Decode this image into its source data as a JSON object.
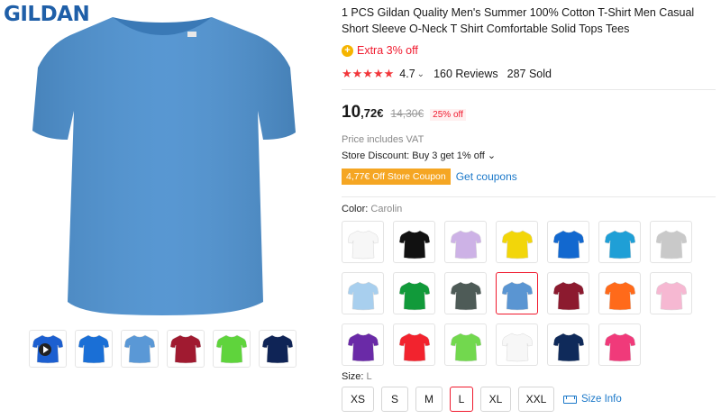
{
  "brand": {
    "logo_text": "GILDAN",
    "logo_color": "#1f5fa8"
  },
  "product": {
    "title": "1 PCS Gildan Quality Men's Summer 100% Cotton T-Shirt Men Casual Short Sleeve O-Neck T Shirt Comfortable Solid Tops Tees",
    "main_color": "#4f92d0"
  },
  "promo": {
    "text": "Extra 3% off",
    "icon": "coin-icon"
  },
  "rating": {
    "stars": "★★★★★",
    "value": "4.7",
    "reviews": "160 Reviews",
    "sold": "287 Sold"
  },
  "price": {
    "integer": "10",
    "fraction": ",72€",
    "original": "14,30€",
    "discount": "25% off",
    "vat_note": "Price includes VAT",
    "store_discount": "Store Discount: Buy 3 get 1% off ⌄",
    "coupon": "4,77€ Off Store Coupon",
    "get_coupons": "Get coupons"
  },
  "color": {
    "label": "Color:",
    "selected": "Carolin",
    "swatches": [
      {
        "color": "#f7f7f7"
      },
      {
        "color": "#111111"
      },
      {
        "color": "#cdb2e6"
      },
      {
        "color": "#f2d60a"
      },
      {
        "color": "#1268cf"
      },
      {
        "color": "#1f9fd6"
      },
      {
        "color": "#c9c9c9"
      },
      {
        "color": "#a8cfee"
      },
      {
        "color": "#119a3a"
      },
      {
        "color": "#4e5b57"
      },
      {
        "color": "#5a95d2",
        "selected": true
      },
      {
        "color": "#8c1a2f"
      },
      {
        "color": "#ff6a1a"
      },
      {
        "color": "#f6b8d2"
      },
      {
        "color": "#6a2aa7"
      },
      {
        "color": "#f2232e"
      },
      {
        "color": "#72d84e"
      },
      {
        "color": "#f7f7f7"
      },
      {
        "color": "#0f2a5a"
      },
      {
        "color": "#f03a7a"
      }
    ]
  },
  "gallery": {
    "thumbs": [
      {
        "color": "#1c5fd0",
        "video": true
      },
      {
        "color": "#1a6fd6"
      },
      {
        "color": "#5a98d6"
      },
      {
        "color": "#a01a30"
      },
      {
        "color": "#5fd43c"
      },
      {
        "color": "#0f2456"
      }
    ]
  },
  "size": {
    "label": "Size:",
    "selected": "L",
    "options": [
      "XS",
      "S",
      "M",
      "L",
      "XL",
      "XXL"
    ],
    "info": "Size Info"
  }
}
